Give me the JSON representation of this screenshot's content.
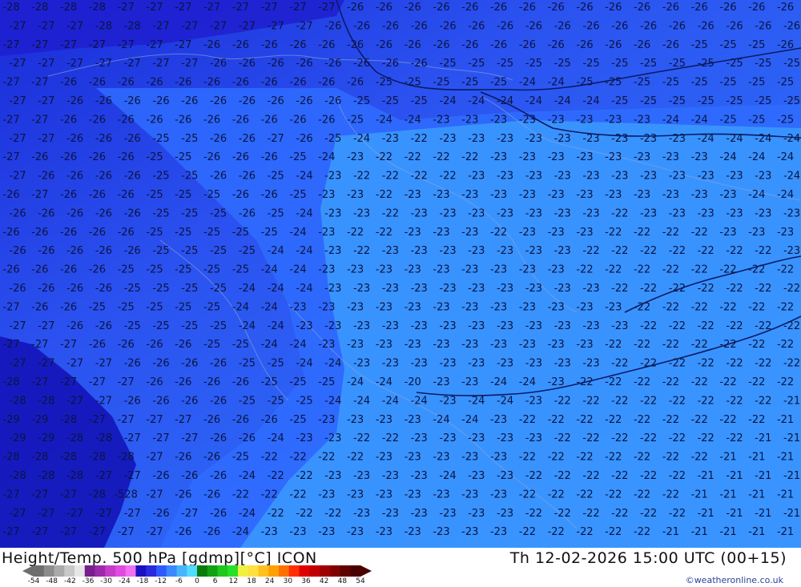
{
  "map": {
    "title": "Height/Temp. 500 hPa [gdmp][°C] ICON",
    "valid_time": "Th 12-02-2026 15:00 UTC (00+15)",
    "credit": "©weatheronline.co.uk",
    "scale_ticks": [
      "-54",
      "-48",
      "-42",
      "-36",
      "-30",
      "-24",
      "-18",
      "-12",
      "-6",
      "0",
      "6",
      "12",
      "18",
      "24",
      "30",
      "36",
      "42",
      "48",
      "54"
    ],
    "scale_colors": [
      "#6e6e6e",
      "#8c8c8c",
      "#aaaaaa",
      "#c8c8c8",
      "#e6e6e6",
      "#7a1e8c",
      "#9c2aa8",
      "#c43cc8",
      "#e04ae0",
      "#f070f0",
      "#1a10c0",
      "#2a2ae0",
      "#2f5aff",
      "#3c88ff",
      "#46b4ff",
      "#50dcff",
      "#0a7a0a",
      "#14a014",
      "#1ec81e",
      "#28e028",
      "#f0f040",
      "#ffe040",
      "#ffc020",
      "#ffa000",
      "#ff7000",
      "#ff3000",
      "#e00000",
      "#c00000",
      "#a00000",
      "#800000",
      "#600000",
      "#4a0000"
    ],
    "temperature_labels": {
      "rows": [
        {
          "row": 0,
          "values": [
            "-28",
            "-28",
            "-28",
            "-28",
            "-27",
            "-27",
            "-27",
            "-27",
            "-27",
            "-27",
            "-27",
            "-27",
            "-26",
            "-26",
            "-26",
            "-26",
            "-26",
            "-26",
            "-26",
            "-26",
            "-26",
            "-26",
            "-26",
            "-26",
            "-26",
            "-26",
            "-26",
            "-26"
          ]
        },
        {
          "row": 1,
          "values": [
            "-27",
            "-27",
            "-27",
            "-28",
            "-28",
            "-27",
            "-27",
            "-27",
            "-27",
            "-27",
            "-27",
            "-26",
            "-26",
            "-26",
            "-26",
            "-26",
            "-26",
            "-26",
            "-26",
            "-26",
            "-26",
            "-26",
            "-26",
            "-26",
            "-26",
            "-26",
            "-26",
            "-26"
          ]
        },
        {
          "row": 2,
          "values": [
            "-27",
            "-27",
            "-27",
            "-27",
            "-27",
            "-27",
            "-27",
            "-26",
            "-26",
            "-26",
            "-26",
            "-26",
            "-26",
            "-26",
            "-26",
            "-26",
            "-26",
            "-26",
            "-26",
            "-26",
            "-26",
            "-26",
            "-26",
            "-26",
            "-25",
            "-25",
            "-25",
            "-26"
          ]
        },
        {
          "row": 3,
          "values": [
            "-27",
            "-27",
            "-27",
            "-27",
            "-27",
            "-27",
            "-27",
            "-26",
            "-26",
            "-26",
            "-26",
            "-26",
            "-26",
            "-26",
            "-26",
            "-25",
            "-25",
            "-25",
            "-25",
            "-25",
            "-25",
            "-25",
            "-25",
            "-25",
            "-25",
            "-25",
            "-25",
            "-25"
          ]
        },
        {
          "row": 4,
          "values": [
            "-27",
            "-27",
            "-26",
            "-26",
            "-26",
            "-26",
            "-26",
            "-26",
            "-26",
            "-26",
            "-26",
            "-26",
            "-26",
            "-25",
            "-25",
            "-25",
            "-25",
            "-25",
            "-24",
            "-24",
            "-25",
            "-25",
            "-25",
            "-25",
            "-25",
            "-25",
            "-25",
            "-25"
          ]
        },
        {
          "row": 5,
          "values": [
            "-27",
            "-27",
            "-26",
            "-26",
            "-26",
            "-26",
            "-26",
            "-26",
            "-26",
            "-26",
            "-26",
            "-26",
            "-25",
            "-25",
            "-25",
            "-24",
            "-24",
            "-24",
            "-24",
            "-24",
            "-24",
            "-25",
            "-25",
            "-25",
            "-25",
            "-25",
            "-25",
            "-25"
          ]
        },
        {
          "row": 6,
          "values": [
            "-27",
            "-27",
            "-26",
            "-26",
            "-26",
            "-26",
            "-26",
            "-26",
            "-26",
            "-26",
            "-26",
            "-26",
            "-25",
            "-24",
            "-24",
            "-23",
            "-23",
            "-23",
            "-23",
            "-23",
            "-23",
            "-23",
            "-23",
            "-24",
            "-24",
            "-25",
            "-25",
            "-25"
          ]
        },
        {
          "row": 7,
          "values": [
            "-27",
            "-27",
            "-26",
            "-26",
            "-26",
            "-25",
            "-25",
            "-26",
            "-26",
            "-27",
            "-26",
            "-25",
            "-24",
            "-23",
            "-22",
            "-23",
            "-23",
            "-23",
            "-23",
            "-23",
            "-23",
            "-23",
            "-23",
            "-23",
            "-24",
            "-24",
            "-24",
            "-24"
          ]
        },
        {
          "row": 8,
          "values": [
            "-27",
            "-26",
            "-26",
            "-26",
            "-26",
            "-25",
            "-25",
            "-26",
            "-26",
            "-26",
            "-25",
            "-24",
            "-23",
            "-22",
            "-22",
            "-22",
            "-22",
            "-23",
            "-23",
            "-23",
            "-23",
            "-23",
            "-23",
            "-23",
            "-23",
            "-24",
            "-24",
            "-24"
          ]
        },
        {
          "row": 9,
          "values": [
            "-27",
            "-26",
            "-26",
            "-26",
            "-26",
            "-25",
            "-25",
            "-26",
            "-26",
            "-25",
            "-24",
            "-23",
            "-22",
            "-22",
            "-22",
            "-22",
            "-23",
            "-23",
            "-23",
            "-23",
            "-23",
            "-23",
            "-23",
            "-23",
            "-23",
            "-23",
            "-23",
            "-24"
          ]
        },
        {
          "row": 10,
          "values": [
            "-26",
            "-27",
            "-26",
            "-26",
            "-26",
            "-25",
            "-25",
            "-25",
            "-26",
            "-26",
            "-25",
            "-23",
            "-23",
            "-22",
            "-23",
            "-23",
            "-23",
            "-23",
            "-23",
            "-23",
            "-23",
            "-23",
            "-23",
            "-23",
            "-23",
            "-23",
            "-24",
            "-24"
          ]
        },
        {
          "row": 11,
          "values": [
            "-26",
            "-26",
            "-26",
            "-26",
            "-26",
            "-25",
            "-25",
            "-25",
            "-26",
            "-25",
            "-24",
            "-23",
            "-23",
            "-22",
            "-23",
            "-23",
            "-23",
            "-23",
            "-23",
            "-23",
            "-23",
            "-22",
            "-23",
            "-23",
            "-23",
            "-23",
            "-23",
            "-23"
          ]
        },
        {
          "row": 12,
          "values": [
            "-26",
            "-26",
            "-26",
            "-26",
            "-26",
            "-25",
            "-25",
            "-25",
            "-25",
            "-25",
            "-24",
            "-23",
            "-22",
            "-22",
            "-23",
            "-23",
            "-23",
            "-22",
            "-23",
            "-23",
            "-23",
            "-22",
            "-22",
            "-22",
            "-22",
            "-23",
            "-23",
            "-23"
          ]
        },
        {
          "row": 13,
          "values": [
            "-26",
            "-26",
            "-26",
            "-26",
            "-26",
            "-25",
            "-25",
            "-25",
            "-25",
            "-24",
            "-24",
            "-23",
            "-22",
            "-23",
            "-23",
            "-23",
            "-23",
            "-23",
            "-23",
            "-23",
            "-22",
            "-22",
            "-22",
            "-22",
            "-22",
            "-22",
            "-22",
            "-23"
          ]
        },
        {
          "row": 14,
          "values": [
            "-26",
            "-26",
            "-26",
            "-26",
            "-25",
            "-25",
            "-25",
            "-25",
            "-25",
            "-24",
            "-24",
            "-23",
            "-23",
            "-23",
            "-23",
            "-23",
            "-23",
            "-23",
            "-23",
            "-23",
            "-22",
            "-22",
            "-22",
            "-22",
            "-22",
            "-22",
            "-22",
            "-22"
          ]
        },
        {
          "row": 15,
          "values": [
            "-26",
            "-26",
            "-26",
            "-26",
            "-25",
            "-25",
            "-25",
            "-25",
            "-24",
            "-24",
            "-24",
            "-23",
            "-23",
            "-23",
            "-23",
            "-23",
            "-23",
            "-23",
            "-23",
            "-23",
            "-23",
            "-22",
            "-22",
            "-22",
            "-22",
            "-22",
            "-22",
            "-22"
          ]
        },
        {
          "row": 16,
          "values": [
            "-27",
            "-26",
            "-26",
            "-25",
            "-25",
            "-25",
            "-25",
            "-25",
            "-24",
            "-24",
            "-23",
            "-23",
            "-23",
            "-23",
            "-23",
            "-23",
            "-23",
            "-23",
            "-23",
            "-23",
            "-23",
            "-23",
            "-22",
            "-22",
            "-22",
            "-22",
            "-22",
            "-22"
          ]
        },
        {
          "row": 17,
          "values": [
            "-27",
            "-27",
            "-26",
            "-26",
            "-25",
            "-25",
            "-25",
            "-25",
            "-24",
            "-24",
            "-23",
            "-23",
            "-23",
            "-23",
            "-23",
            "-23",
            "-23",
            "-23",
            "-23",
            "-23",
            "-23",
            "-23",
            "-22",
            "-22",
            "-22",
            "-22",
            "-22",
            "-22"
          ]
        },
        {
          "row": 18,
          "values": [
            "-27",
            "-27",
            "-27",
            "-26",
            "-26",
            "-26",
            "-26",
            "-25",
            "-25",
            "-24",
            "-24",
            "-23",
            "-23",
            "-23",
            "-23",
            "-23",
            "-23",
            "-23",
            "-23",
            "-23",
            "-23",
            "-22",
            "-22",
            "-22",
            "-22",
            "-22",
            "-22",
            "-22"
          ]
        },
        {
          "row": 19,
          "values": [
            "-27",
            "-27",
            "-27",
            "-27",
            "-26",
            "-26",
            "-26",
            "-26",
            "-25",
            "-25",
            "-24",
            "-24",
            "-23",
            "-23",
            "-23",
            "-23",
            "-23",
            "-23",
            "-23",
            "-23",
            "-23",
            "-22",
            "-22",
            "-22",
            "-22",
            "-22",
            "-22",
            "-22"
          ]
        },
        {
          "row": 20,
          "values": [
            "-28",
            "-27",
            "-27",
            "-27",
            "-27",
            "-26",
            "-26",
            "-26",
            "-26",
            "-25",
            "-25",
            "-25",
            "-24",
            "-24",
            "-20",
            "-23",
            "-23",
            "-24",
            "-24",
            "-23",
            "-22",
            "-22",
            "-22",
            "-22",
            "-22",
            "-22",
            "-22",
            "-22"
          ]
        },
        {
          "row": 21,
          "values": [
            "-28",
            "-28",
            "-27",
            "-27",
            "-26",
            "-26",
            "-26",
            "-26",
            "-25",
            "-25",
            "-25",
            "-24",
            "-24",
            "-24",
            "-24",
            "-23",
            "-24",
            "-24",
            "-23",
            "-22",
            "-22",
            "-22",
            "-22",
            "-22",
            "-22",
            "-22",
            "-22",
            "-21"
          ]
        },
        {
          "row": 22,
          "values": [
            "-29",
            "-29",
            "-28",
            "-27",
            "-27",
            "-27",
            "-27",
            "-26",
            "-26",
            "-26",
            "-25",
            "-23",
            "-23",
            "-23",
            "-23",
            "-24",
            "-24",
            "-23",
            "-22",
            "-22",
            "-22",
            "-22",
            "-22",
            "-22",
            "-22",
            "-22",
            "-22",
            "-21"
          ]
        },
        {
          "row": 23,
          "values": [
            "-29",
            "-29",
            "-28",
            "-28",
            "-27",
            "-27",
            "-27",
            "-26",
            "-26",
            "-24",
            "-23",
            "-23",
            "-22",
            "-22",
            "-23",
            "-23",
            "-23",
            "-23",
            "-23",
            "-22",
            "-22",
            "-22",
            "-22",
            "-22",
            "-22",
            "-22",
            "-21",
            "-21"
          ]
        },
        {
          "row": 24,
          "values": [
            "-28",
            "-28",
            "-28",
            "-28",
            "-28",
            "-27",
            "-26",
            "-26",
            "-25",
            "-22",
            "-22",
            "-22",
            "-22",
            "-23",
            "-23",
            "-23",
            "-23",
            "-23",
            "-22",
            "-22",
            "-22",
            "-22",
            "-22",
            "-22",
            "-22",
            "-21",
            "-21",
            "-21"
          ]
        },
        {
          "row": 25,
          "values": [
            "-28",
            "-28",
            "-28",
            "-27",
            "-27",
            "-26",
            "-26",
            "-26",
            "-24",
            "-22",
            "-22",
            "-23",
            "-23",
            "-23",
            "-23",
            "-24",
            "-23",
            "-23",
            "-22",
            "-22",
            "-22",
            "-22",
            "-22",
            "-22",
            "-21",
            "-21",
            "-21",
            "-21"
          ]
        },
        {
          "row": 26,
          "values": [
            "-27",
            "-27",
            "-27",
            "-28",
            "-528",
            "-27",
            "-26",
            "-26",
            "-22",
            "-22",
            "-22",
            "-23",
            "-23",
            "-23",
            "-23",
            "-23",
            "-23",
            "-23",
            "-22",
            "-22",
            "-22",
            "-22",
            "-22",
            "-22",
            "-21",
            "-21",
            "-21",
            "-21"
          ]
        },
        {
          "row": 27,
          "values": [
            "-27",
            "-27",
            "-27",
            "-27",
            "-27",
            "-26",
            "-27",
            "-26",
            "-24",
            "-22",
            "-22",
            "-22",
            "-23",
            "-23",
            "-23",
            "-23",
            "-23",
            "-23",
            "-22",
            "-22",
            "-22",
            "-22",
            "-22",
            "-22",
            "-21",
            "-21",
            "-21",
            "-21"
          ]
        },
        {
          "row": 28,
          "values": [
            "-27",
            "-27",
            "-27",
            "-27",
            "-27",
            "-27",
            "-26",
            "-26",
            "-24",
            "-23",
            "-23",
            "-23",
            "-23",
            "-23",
            "-23",
            "-23",
            "-23",
            "-23",
            "-22",
            "-22",
            "-22",
            "-22",
            "-22",
            "-21",
            "-21",
            "-21",
            "-21",
            "-21"
          ]
        }
      ]
    }
  }
}
